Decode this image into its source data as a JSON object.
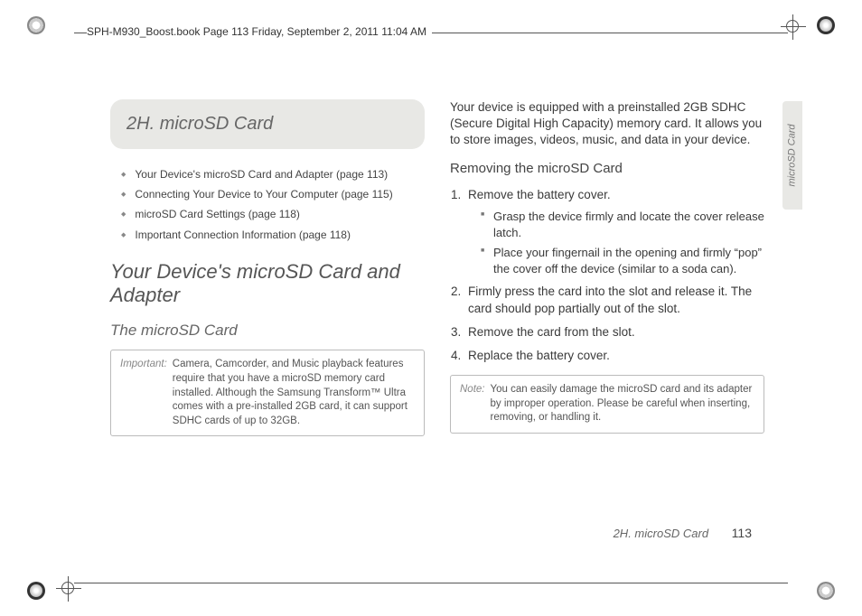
{
  "print_header": "SPH-M930_Boost.book  Page 113  Friday, September 2, 2011  11:04 AM",
  "side_tab": "microSD Card",
  "chapter": {
    "number": "2H.",
    "title": "microSD Card"
  },
  "toc": [
    "Your Device's microSD Card and Adapter (page 113)",
    "Connecting Your Device to Your Computer (page 115)",
    "microSD Card Settings (page 118)",
    "Important Connection Information (page 118)"
  ],
  "section_heading": "Your Device's microSD Card and Adapter",
  "subsection_heading": "The microSD Card",
  "important": {
    "label": "Important:",
    "text": "Camera, Camcorder, and Music playback features require that you have a microSD memory card installed. Although the Samsung Transform™ Ultra comes with a pre-installed 2GB card, it can support SDHC cards of up to 32GB."
  },
  "right_intro": "Your device is equipped with a preinstalled 2GB SDHC (Secure Digital High Capacity) memory card. It allows you to store images, videos, music, and data in your device.",
  "removing_heading": "Removing the microSD Card",
  "steps": {
    "s1": "Remove the battery cover.",
    "s1a": "Grasp the device firmly and locate the cover release latch.",
    "s1b": "Place your fingernail in the opening and firmly “pop” the cover off the device (similar to a soda can).",
    "s2": "Firmly press the card into the slot and release it. The card should pop partially out of the slot.",
    "s3": "Remove the card from the slot.",
    "s4": "Replace the battery cover."
  },
  "note": {
    "label": "Note:",
    "text": "You can easily damage the microSD card and its adapter by improper operation. Please be careful when inserting, removing, or handling it."
  },
  "footer": {
    "label": "2H. microSD Card",
    "page": "113"
  }
}
